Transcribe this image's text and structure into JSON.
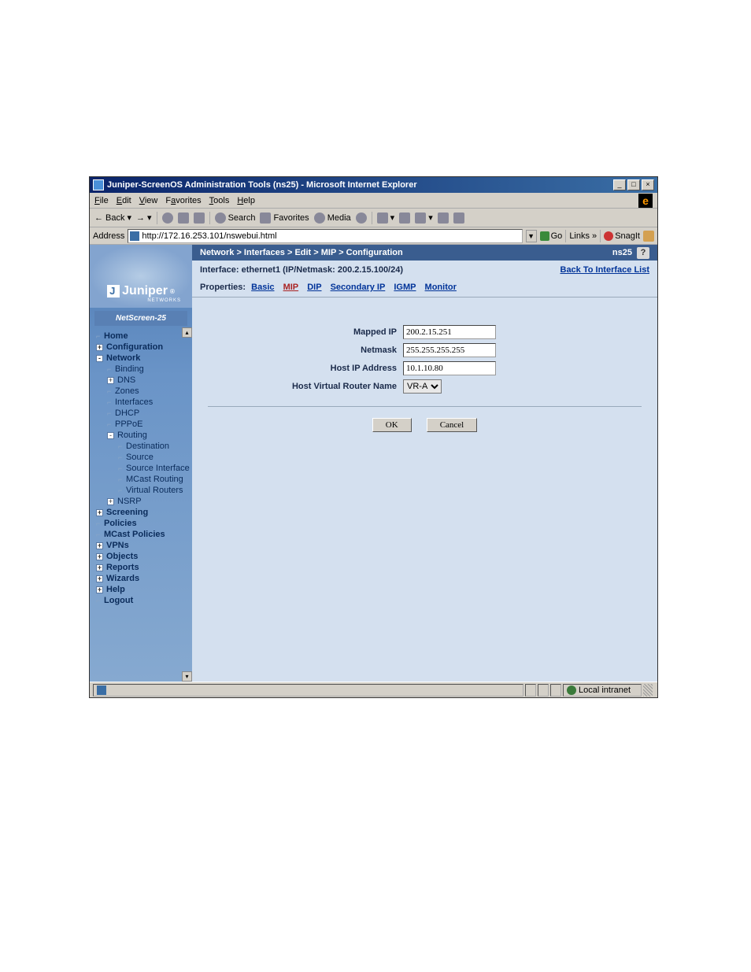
{
  "window": {
    "title": "Juniper-ScreenOS Administration Tools (ns25) - Microsoft Internet Explorer"
  },
  "menubar": {
    "file": "File",
    "edit": "Edit",
    "view": "View",
    "favorites": "Favorites",
    "tools": "Tools",
    "help": "Help"
  },
  "toolbar": {
    "back": "Back",
    "search": "Search",
    "favorites": "Favorites",
    "media": "Media"
  },
  "addressbar": {
    "label": "Address",
    "url": "http://172.16.253.101/nswebui.html",
    "go": "Go",
    "links": "Links",
    "snagit": "SnagIt"
  },
  "sidebar": {
    "logo": "Juniper",
    "logosub": "NETWORKS",
    "product": "NetScreen-25",
    "items": [
      {
        "label": "Home",
        "lvl": 1,
        "bold": true,
        "exp": ""
      },
      {
        "label": "Configuration",
        "lvl": 1,
        "bold": true,
        "exp": "+"
      },
      {
        "label": "Network",
        "lvl": 1,
        "bold": true,
        "exp": "-"
      },
      {
        "label": "Binding",
        "lvl": 2,
        "bold": false,
        "exp": ""
      },
      {
        "label": "DNS",
        "lvl": 2,
        "bold": false,
        "exp": "+"
      },
      {
        "label": "Zones",
        "lvl": 2,
        "bold": false,
        "exp": ""
      },
      {
        "label": "Interfaces",
        "lvl": 2,
        "bold": false,
        "exp": ""
      },
      {
        "label": "DHCP",
        "lvl": 2,
        "bold": false,
        "exp": ""
      },
      {
        "label": "PPPoE",
        "lvl": 2,
        "bold": false,
        "exp": ""
      },
      {
        "label": "Routing",
        "lvl": 2,
        "bold": false,
        "exp": "-"
      },
      {
        "label": "Destination",
        "lvl": 3,
        "bold": false,
        "exp": ""
      },
      {
        "label": "Source",
        "lvl": 3,
        "bold": false,
        "exp": ""
      },
      {
        "label": "Source Interface",
        "lvl": 3,
        "bold": false,
        "exp": ""
      },
      {
        "label": "MCast Routing",
        "lvl": 3,
        "bold": false,
        "exp": ""
      },
      {
        "label": "Virtual Routers",
        "lvl": 3,
        "bold": false,
        "exp": ""
      },
      {
        "label": "NSRP",
        "lvl": 2,
        "bold": false,
        "exp": "+"
      },
      {
        "label": "Screening",
        "lvl": 1,
        "bold": true,
        "exp": "+"
      },
      {
        "label": "Policies",
        "lvl": 1,
        "bold": true,
        "exp": ""
      },
      {
        "label": "MCast Policies",
        "lvl": 1,
        "bold": true,
        "exp": ""
      },
      {
        "label": "VPNs",
        "lvl": 1,
        "bold": true,
        "exp": "+"
      },
      {
        "label": "Objects",
        "lvl": 1,
        "bold": true,
        "exp": "+"
      },
      {
        "label": "Reports",
        "lvl": 1,
        "bold": true,
        "exp": "+"
      },
      {
        "label": "Wizards",
        "lvl": 1,
        "bold": true,
        "exp": "+"
      },
      {
        "label": "Help",
        "lvl": 1,
        "bold": true,
        "exp": "+"
      },
      {
        "label": "Logout",
        "lvl": 1,
        "bold": true,
        "exp": ""
      }
    ]
  },
  "main": {
    "breadcrumb": "Network > Interfaces > Edit > MIP > Configuration",
    "device": "ns25",
    "interface_label": "Interface: ethernet1 (IP/Netmask: 200.2.15.100/24)",
    "back_link": "Back To Interface List",
    "properties_label": "Properties:",
    "tabs": {
      "basic": "Basic",
      "mip": "MIP",
      "dip": "DIP",
      "secip": "Secondary IP",
      "igmp": "IGMP",
      "monitor": "Monitor"
    },
    "form": {
      "mapped_ip_label": "Mapped IP",
      "mapped_ip_value": "200.2.15.251",
      "netmask_label": "Netmask",
      "netmask_value": "255.255.255.255",
      "hostip_label": "Host IP Address",
      "hostip_value": "10.1.10.80",
      "vrouter_label": "Host Virtual Router Name",
      "vrouter_value": "VR-A"
    },
    "buttons": {
      "ok": "OK",
      "cancel": "Cancel"
    }
  },
  "statusbar": {
    "zone": "Local intranet"
  }
}
